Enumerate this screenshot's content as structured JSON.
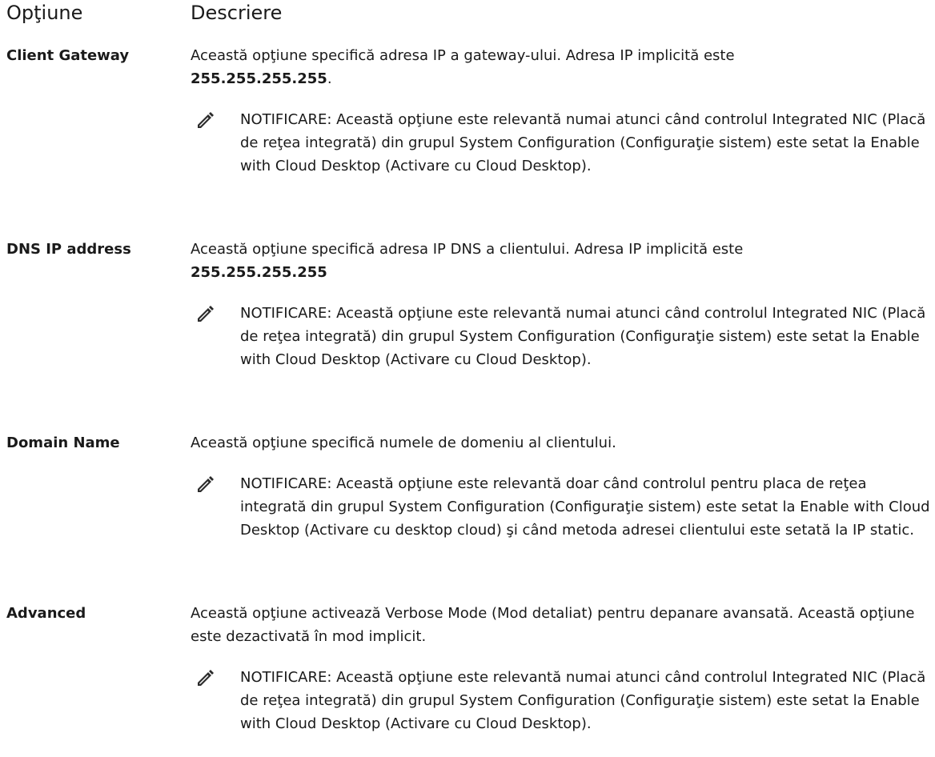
{
  "header": {
    "option_col": "Opţiune",
    "description_col": "Descriere"
  },
  "rows": [
    {
      "option": "Client Gateway",
      "desc_text": "Această opţiune specifică adresa IP a gateway-ului. Adresa IP implicită este",
      "desc_value": "255.255.255.255",
      "desc_suffix": ".",
      "note_label": "NOTIFICARE:",
      "note_text": " Această opţiune este relevantă numai atunci când controlul Integrated NIC (Placă de reţea integrată) din grupul System Configuration (Configuraţie sistem) este setat la Enable with Cloud Desktop (Activare cu Cloud Desktop)."
    },
    {
      "option": "DNS IP address",
      "desc_text": "Această opţiune specifică adresa IP DNS a clientului. Adresa IP implicită este",
      "desc_value": "255.255.255.255",
      "desc_suffix": "",
      "note_label": "NOTIFICARE:",
      "note_text": " Această opţiune este relevantă numai atunci când controlul Integrated NIC (Placă de reţea integrată) din grupul System Configuration (Configuraţie sistem) este setat la Enable with Cloud Desktop (Activare cu Cloud Desktop)."
    },
    {
      "option": "Domain Name",
      "desc_text": "Această opţiune specifică numele de domeniu al clientului.",
      "note_label": "NOTIFICARE:",
      "note_text": " Această opţiune este relevantă doar când controlul pentru placa de reţea integrată din grupul System Configuration (Configuraţie sistem) este setat la Enable with Cloud Desktop (Activare cu desktop cloud) şi când metoda adresei clientului este setată la IP static."
    },
    {
      "option": "Advanced",
      "desc_text": "Această opţiune activează Verbose Mode (Mod detaliat) pentru depanare avansată. Această opţiune este dezactivată în mod implicit.",
      "note_label": "NOTIFICARE:",
      "note_text": " Această opţiune este relevantă numai atunci când controlul Integrated NIC (Placă de reţea integrată) din grupul System Configuration (Configuraţie sistem) este setat la Enable with Cloud Desktop (Activare cu Cloud Desktop)."
    }
  ]
}
